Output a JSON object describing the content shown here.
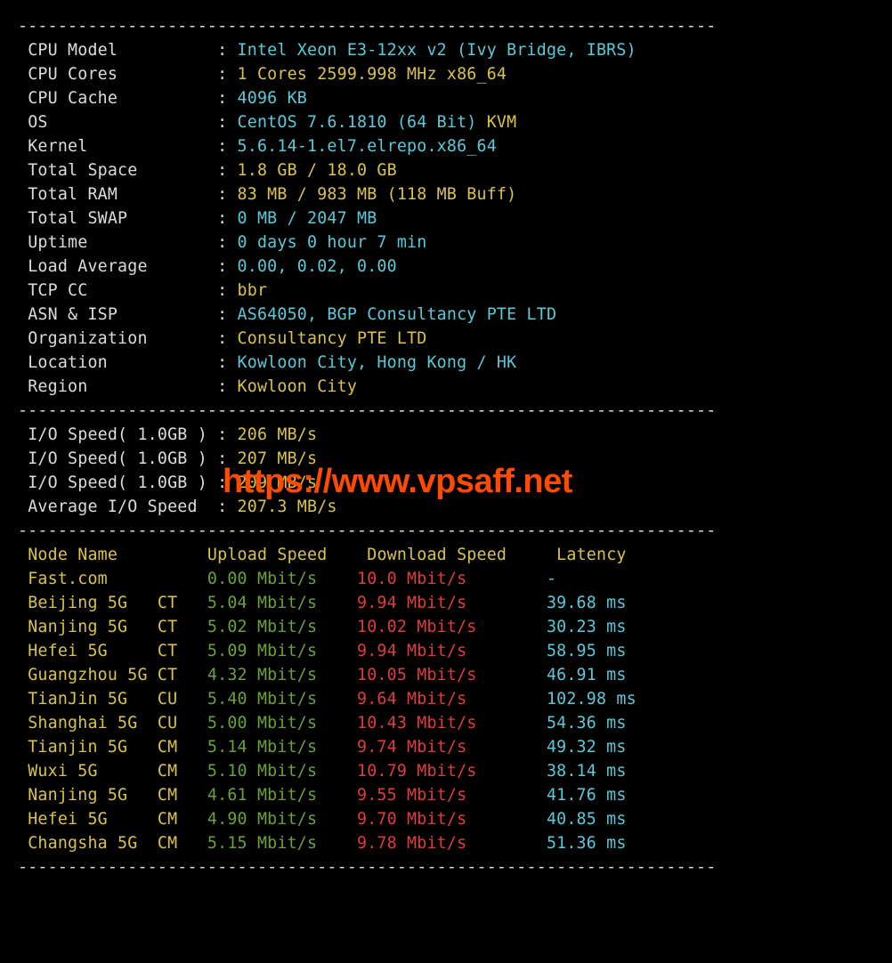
{
  "hr": "----------------------------------------------------------------------",
  "info": [
    {
      "label": " CPU Model          ",
      "parts": [
        {
          "t": "Intel Xeon E3-12xx v2 (Ivy Bridge, IBRS)",
          "c": "cyan"
        }
      ]
    },
    {
      "label": " CPU Cores          ",
      "parts": [
        {
          "t": "1 Cores 2599.998 MHz x86_64",
          "c": "yellow"
        }
      ]
    },
    {
      "label": " CPU Cache          ",
      "parts": [
        {
          "t": "4096 KB",
          "c": "cyan"
        }
      ]
    },
    {
      "label": " OS                 ",
      "parts": [
        {
          "t": "CentOS 7.6.1810 (64 Bit) ",
          "c": "cyan"
        },
        {
          "t": "KVM",
          "c": "yellow"
        }
      ]
    },
    {
      "label": " Kernel             ",
      "parts": [
        {
          "t": "5.6.14-1.el7.elrepo.x86_64",
          "c": "cyan"
        }
      ]
    },
    {
      "label": " Total Space        ",
      "parts": [
        {
          "t": "1.8 GB / 18.0 GB",
          "c": "yellow"
        }
      ]
    },
    {
      "label": " Total RAM          ",
      "parts": [
        {
          "t": "83 MB / 983 MB (118 MB Buff)",
          "c": "yellow"
        }
      ]
    },
    {
      "label": " Total SWAP         ",
      "parts": [
        {
          "t": "0 MB / 2047 MB",
          "c": "cyan"
        }
      ]
    },
    {
      "label": " Uptime             ",
      "parts": [
        {
          "t": "0 days 0 hour 7 min",
          "c": "cyan"
        }
      ]
    },
    {
      "label": " Load Average       ",
      "parts": [
        {
          "t": "0.00, 0.02, 0.00",
          "c": "cyan"
        }
      ]
    },
    {
      "label": " TCP CC             ",
      "parts": [
        {
          "t": "bbr",
          "c": "yellow"
        }
      ]
    },
    {
      "label": " ASN & ISP          ",
      "parts": [
        {
          "t": "AS64050, BGP Consultancy PTE LTD",
          "c": "cyan"
        }
      ]
    },
    {
      "label": " Organization       ",
      "parts": [
        {
          "t": "Consultancy PTE LTD",
          "c": "yellow"
        }
      ]
    },
    {
      "label": " Location           ",
      "parts": [
        {
          "t": "Kowloon City, Hong Kong / HK",
          "c": "cyan"
        }
      ]
    },
    {
      "label": " Region             ",
      "parts": [
        {
          "t": "Kowloon City",
          "c": "yellow"
        }
      ]
    }
  ],
  "io": [
    {
      "label": " I/O Speed( 1.0GB ) ",
      "value": "206 MB/s"
    },
    {
      "label": " I/O Speed( 1.0GB ) ",
      "value": "207 MB/s"
    },
    {
      "label": " I/O Speed( 1.0GB ) ",
      "value": "209 MB/s"
    },
    {
      "label": " Average I/O Speed  ",
      "value": "207.3 MB/s"
    }
  ],
  "speed_header": {
    "node": " Node Name        ",
    "upl": " Upload Speed   ",
    "dl": " Download Speed    ",
    "lat": " Latency     "
  },
  "speed": [
    {
      "node": " Fast.com         ",
      "up": " 0.00 Mbit/s   ",
      "dl": " 10.0 Mbit/s       ",
      "lat": " -           "
    },
    {
      "node": " Beijing 5G   CT  ",
      "up": " 5.04 Mbit/s   ",
      "dl": " 9.94 Mbit/s       ",
      "lat": " 39.68 ms    "
    },
    {
      "node": " Nanjing 5G   CT  ",
      "up": " 5.02 Mbit/s   ",
      "dl": " 10.02 Mbit/s      ",
      "lat": " 30.23 ms    "
    },
    {
      "node": " Hefei 5G     CT  ",
      "up": " 5.09 Mbit/s   ",
      "dl": " 9.94 Mbit/s       ",
      "lat": " 58.95 ms    "
    },
    {
      "node": " Guangzhou 5G CT  ",
      "up": " 4.32 Mbit/s   ",
      "dl": " 10.05 Mbit/s      ",
      "lat": " 46.91 ms    "
    },
    {
      "node": " TianJin 5G   CU  ",
      "up": " 5.40 Mbit/s   ",
      "dl": " 9.64 Mbit/s       ",
      "lat": " 102.98 ms   "
    },
    {
      "node": " Shanghai 5G  CU  ",
      "up": " 5.00 Mbit/s   ",
      "dl": " 10.43 Mbit/s      ",
      "lat": " 54.36 ms    "
    },
    {
      "node": " Tianjin 5G   CM  ",
      "up": " 5.14 Mbit/s   ",
      "dl": " 9.74 Mbit/s       ",
      "lat": " 49.32 ms    "
    },
    {
      "node": " Wuxi 5G      CM  ",
      "up": " 5.10 Mbit/s   ",
      "dl": " 10.79 Mbit/s      ",
      "lat": " 38.14 ms    "
    },
    {
      "node": " Nanjing 5G   CM  ",
      "up": " 4.61 Mbit/s   ",
      "dl": " 9.55 Mbit/s       ",
      "lat": " 41.76 ms    "
    },
    {
      "node": " Hefei 5G     CM  ",
      "up": " 4.90 Mbit/s   ",
      "dl": " 9.70 Mbit/s       ",
      "lat": " 40.85 ms    "
    },
    {
      "node": " Changsha 5G  CM  ",
      "up": " 5.15 Mbit/s   ",
      "dl": " 9.78 Mbit/s       ",
      "lat": " 51.36 ms    "
    }
  ],
  "watermark": "https://www.vpsaff.net"
}
